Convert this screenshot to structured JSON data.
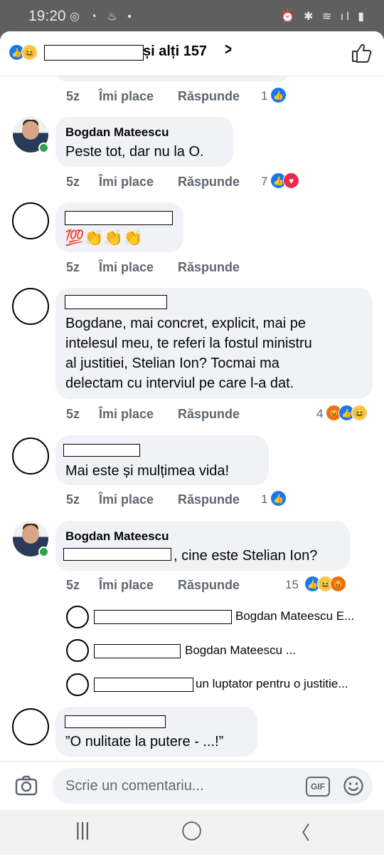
{
  "status_bar": {
    "time": "19:20",
    "left_icons": "◎ ◔ ♨ •",
    "right_icons": "⏰ ✱ ≋ ıl ▮"
  },
  "header": {
    "title": "și alți 157",
    "reactions": [
      "like-icon",
      "haha-icon"
    ]
  },
  "comments": [
    {
      "time": "5z",
      "like": "Îmi place",
      "reply": "Răspunde",
      "reaction_count": "1"
    },
    {
      "author": "Bogdan Mateescu",
      "text": "Peste tot, dar nu la O.",
      "time": "5z",
      "like": "Îmi place",
      "reply": "Răspunde",
      "reaction_count": "7"
    },
    {
      "emojis": "💯👏👏👏",
      "time": "5z",
      "like": "Îmi place",
      "reply": "Răspunde"
    },
    {
      "text_lines": [
        "Bogdane, mai concret, explicit, mai pe",
        "intelesul meu, te referi la fostul ministru",
        "al justitiei, Stelian Ion? Tocmai ma",
        "delectam cu interviul pe care l-a dat."
      ],
      "time": "5z",
      "like": "Îmi place",
      "reply": "Răspunde",
      "reaction_count": "4"
    },
    {
      "text": "Mai este și mulțimea vida!",
      "time": "5z",
      "like": "Îmi place",
      "reply": "Răspunde",
      "reaction_count": "1"
    },
    {
      "author": "Bogdan Mateescu",
      "text": ", cine este Stelian Ion?",
      "time": "5z",
      "like": "Îmi place",
      "reply": "Răspunde",
      "reaction_count": "15"
    },
    {
      "text": "”O nulitate la putere - ...!”"
    }
  ],
  "replies": [
    {
      "text": "Bogdan Mateescu E..."
    },
    {
      "text": "Bogdan Mateescu ..."
    },
    {
      "text": "un luptator pentru o justitie..."
    }
  ],
  "composer": {
    "placeholder": "Scrie un comentariu..."
  },
  "navbar": {
    "recent": "|||",
    "home": "◯",
    "back": "〈"
  },
  "colors": {
    "like": "#1877f2",
    "love": "#f0284a",
    "haha": "#f7c64b",
    "angry": "#e9710f",
    "bubble": "#f0f2f5",
    "action": "#606770"
  }
}
